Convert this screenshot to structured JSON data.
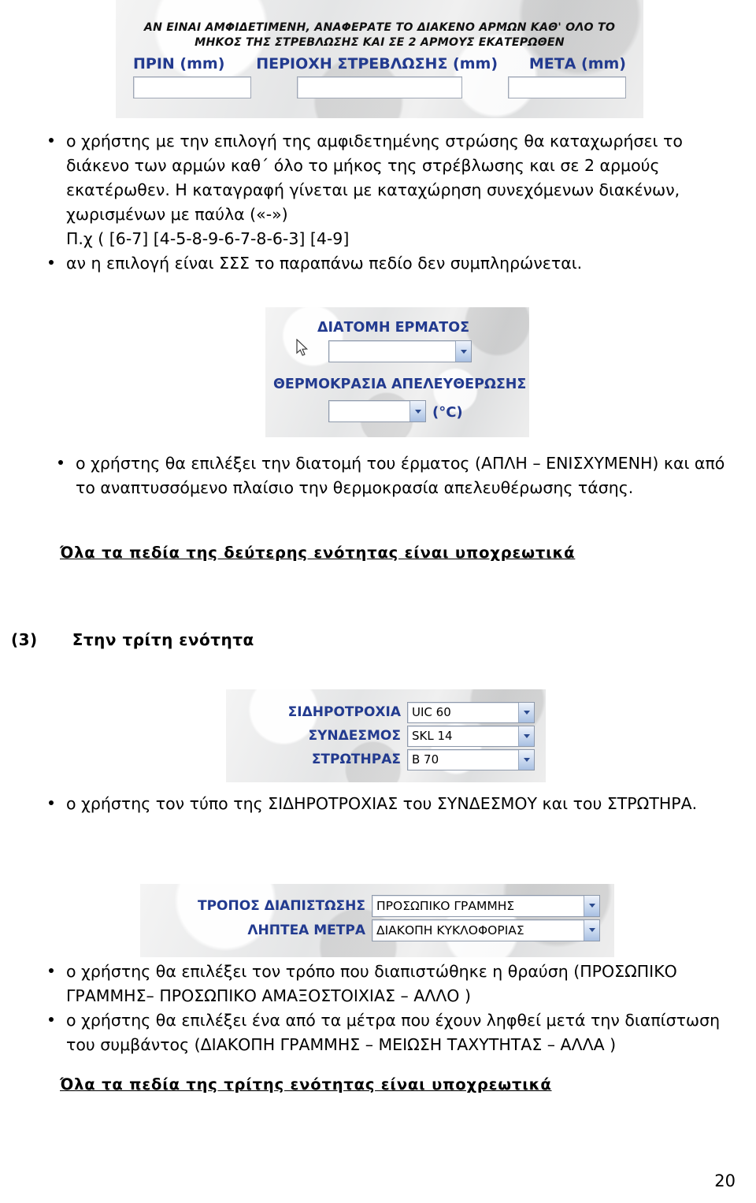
{
  "page": {
    "number": "20"
  },
  "shot_joint": {
    "banner_line1": "ΑΝ ΕΙΝΑΙ ΑΜΦΙΔΕΤΙΜΕΝΗ, ΑΝΑΦΕΡΑΤΕ ΤΟ ΔΙΑΚΕΝΟ ΑΡΜΩΝ ΚΑΘ' ΟΛΟ ΤΟ",
    "banner_line2": "ΜΗΚΟΣ ΤΗΣ ΣΤΡΕΒΛΩΣΗΣ ΚΑΙ ΣΕ 2 ΑΡΜΟΥΣ ΕΚΑΤΕΡΩΘΕΝ",
    "fields": [
      {
        "label": "ΠΡΙΝ (mm)",
        "value": ""
      },
      {
        "label": "ΠΕΡΙΟΧΗ ΣΤΡΕΒΛΩΣΗΣ (mm)",
        "value": ""
      },
      {
        "label": "ΜΕΤΑ (mm)",
        "value": ""
      }
    ]
  },
  "shot_ballast": {
    "label_section": "ΔΙΑΤΟΜΗ ΕΡΜΑΤΟΣ",
    "label_temperature": "ΘΕΡΜΟΚΡΑΣΙΑ ΑΠΕΛΕΥΘΕΡΩΣΗΣ",
    "unit": "(°C)",
    "section_value": "",
    "temperature_value": ""
  },
  "shot_track": {
    "rows": [
      {
        "label": "ΣΙΔΗΡΟΤΡΟΧΙΑ",
        "value": "UIC 60"
      },
      {
        "label": "ΣΥΝΔΕΣΜΟΣ",
        "value": "SKL 14"
      },
      {
        "label": "ΣΤΡΩΤΗΡΑΣ",
        "value": "B 70"
      }
    ]
  },
  "shot_measures": {
    "rows": [
      {
        "label": "ΤΡΟΠΟΣ ΔΙΑΠΙΣΤΩΣΗΣ",
        "value": "ΠΡΟΣΩΠΙΚΟ ΓΡΑΜΜΗΣ"
      },
      {
        "label": "ΛΗΠΤΕΑ ΜΕΤΡΑ",
        "value": "ΔΙΑΚΟΠΗ ΚΥΚΛΟΦΟΡΙΑΣ"
      }
    ]
  },
  "body": {
    "bullet_1": "ο χρήστης με την επιλογή της αμφιδετημένης στρώσης θα καταχωρήσει το διάκενο των αρμών καθ΄ όλο το μήκος της στρέβλωσης και σε 2 αρμούς εκατέρωθεν. Η καταγραφή γίνεται με καταχώρηση συνεχόμενων διακένων, χωρισμένων με παύλα («-»)",
    "bullet_1_example": "Π.χ  ( [6-7]  [4-5-8-9-6-7-8-6-3]  [4-9]",
    "bullet_2": "αν η επιλογή είναι ΣΣΣ το παραπάνω πεδίο δεν συμπληρώνεται.",
    "bullet_3": "ο χρήστης θα επιλέξει την διατομή του έρματος (ΑΠΛΗ – ΕΝΙΣΧΥΜΕΝΗ) και από το αναπτυσσόμενο πλαίσιο την θερμοκρασία  απελευθέρωσης τάσης.",
    "note_section_2": "Όλα  τα  πεδία  της  δεύτερης  ενότητας   είναι  υποχρεωτικά",
    "section_3_number": "(3)",
    "section_3_title": "Στην  τρίτη  ενότητα",
    "bullet_4": "ο  χρήστης  τον  τύπο  της  ΣΙΔΗΡΟΤΡΟΧΙΑΣ  του  ΣΥΝΔΕΣΜΟΥ   και  του ΣΤΡΩΤΗΡΑ.",
    "bullet_5": "ο χρήστης θα επιλέξει  τον τρόπο που διαπιστώθηκε η  θραύση (ΠΡΟΣΩΠΙΚΟ ΓΡΑΜΜΗΣ– ΠΡΟΣΩΠΙΚΟ ΑΜΑΞΟΣΤΟΙΧΙΑΣ – ΑΛΛΟ )",
    "bullet_6": "ο χρήστης θα επιλέξει ένα από τα  μέτρα  που  έχουν  ληφθεί  μετά  την  διαπίστωση του  συμβάντος  (ΔΙΑΚΟΠΗ ΓΡΑΜΜΗΣ – ΜΕΙΩΣΗ ΤΑΧΥΤΗΤΑΣ –  ΑΛΛΑ )",
    "note_section_3": "Όλα  τα  πεδία  της  τρίτης  ενότητας   είναι  υποχρεωτικά"
  }
}
